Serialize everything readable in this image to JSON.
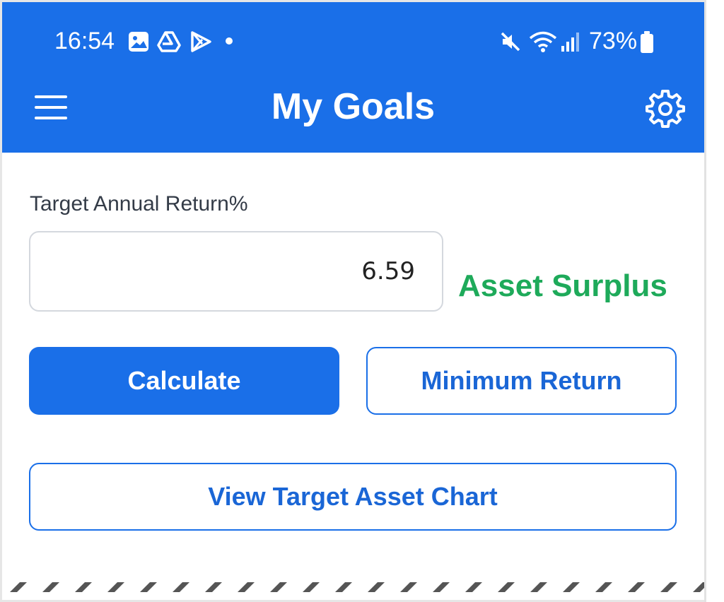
{
  "status_bar": {
    "time": "16:54",
    "left_icons": [
      "gallery-icon",
      "drive-icon",
      "play-store-icon"
    ],
    "right_icons": [
      "mute-icon",
      "wifi-icon",
      "signal-icon",
      "battery-icon"
    ],
    "battery_percent": "73%"
  },
  "app_bar": {
    "title": "My Goals",
    "left_icon": "menu-icon",
    "right_icon": "gear-icon",
    "color": "#1a6fe8"
  },
  "form": {
    "target_return_label": "Target Annual Return%",
    "target_return_value": "6.59",
    "result_text": "Asset Surplus",
    "result_color": "#1eaa5a"
  },
  "buttons": {
    "calculate": "Calculate",
    "minimum_return": "Minimum Return",
    "view_chart": "View Target Asset Chart"
  }
}
